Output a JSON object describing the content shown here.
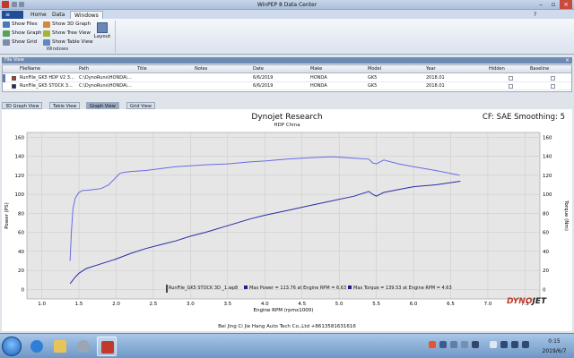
{
  "window": {
    "title": "WinPEP 8 Data Center"
  },
  "ribbon_tabs": [
    "Home",
    "Data",
    "Windows"
  ],
  "ribbon": {
    "buttons": [
      "Show Files",
      "Show Graph",
      "Show Grid",
      "Show 3D Graph",
      "Show Tree View",
      "Show Table View"
    ],
    "layout_label": "Layout",
    "group_label": "Windows"
  },
  "file_view": {
    "title": "File View",
    "columns": [
      "FileName",
      "Path",
      "Title",
      "Notes",
      "Date",
      "Make",
      "Model",
      "Year",
      "Hidden",
      "Baseline"
    ],
    "rows": [
      {
        "filename": "RunFile_GK5 HDP V2 3...",
        "path": "C:\\DynoRuns\\HONDA\\...",
        "title": "",
        "notes": "",
        "date": "6/6/2019",
        "make": "HONDA",
        "model": "GK5",
        "year": "2018.01",
        "color": "#c0392b"
      },
      {
        "filename": "RunFile_GK5 STOCK 3...",
        "path": "C:\\DynoRuns\\HONDA\\...",
        "title": "",
        "notes": "",
        "date": "6/6/2019",
        "make": "HONDA",
        "model": "GK5",
        "year": "2018.01",
        "color": "#1a237e"
      }
    ]
  },
  "view_tabs": [
    "3D Graph View",
    "Table View",
    "Graph View",
    "Grid View"
  ],
  "graph": {
    "title": "Dynojet Research",
    "subtitle": "HDP China",
    "cf_text": "CF: SAE Smoothing: 5",
    "footer": "Bei Jing Ci Jie Hang Auto Tech Co.,Ltd +8613581631616",
    "legend": {
      "file": "RunFile_GK5 STOCK 3D _1.wp8",
      "power": "Max Power = 113.76 at Engine RPM = 6.63",
      "torque": "Max Torque = 139.53 at Engine RPM = 4.63"
    },
    "logo": {
      "red": "DYNO",
      "dark": "JET"
    }
  },
  "chart_data": {
    "type": "line",
    "title": "Dynojet Research",
    "subtitle": "HDP China",
    "xlabel": "Engine RPM (rpmx1000)",
    "ylabel": "Power (PS)",
    "y2label": "Torque (Nm)",
    "xlim": [
      0.8,
      7.7
    ],
    "ylim": [
      -10,
      165
    ],
    "y2lim": [
      -10,
      165
    ],
    "xticks": [
      "1.0",
      "1.5",
      "2.0",
      "2.5",
      "3.0",
      "3.5",
      "4.0",
      "4.5",
      "5.0",
      "5.5",
      "6.0",
      "6.5",
      "7.0",
      "7.5"
    ],
    "yticks": [
      "0",
      "20",
      "40",
      "60",
      "80",
      "100",
      "120",
      "140",
      "160"
    ],
    "grid": true,
    "series": [
      {
        "name": "Torque",
        "color": "#6a6ae8",
        "x": [
          1.38,
          1.4,
          1.42,
          1.45,
          1.5,
          1.55,
          1.6,
          1.7,
          1.8,
          1.9,
          2.0,
          2.05,
          2.1,
          2.2,
          2.4,
          2.6,
          2.8,
          3.0,
          3.2,
          3.5,
          3.8,
          4.0,
          4.3,
          4.6,
          4.9,
          5.2,
          5.4,
          5.45,
          5.5,
          5.6,
          5.8,
          6.0,
          6.3,
          6.62
        ],
        "y": [
          30,
          62,
          85,
          96,
          102,
          104,
          104,
          105,
          106,
          110,
          118,
          122,
          123,
          124,
          125,
          127,
          129,
          130,
          131,
          132,
          134,
          135,
          137,
          138.5,
          139.5,
          138,
          137,
          133,
          132,
          136,
          132,
          129,
          125,
          120
        ]
      },
      {
        "name": "Power",
        "color": "#2a2aa8",
        "x": [
          1.38,
          1.4,
          1.45,
          1.5,
          1.6,
          1.8,
          2.0,
          2.2,
          2.4,
          2.6,
          2.8,
          3.0,
          3.2,
          3.5,
          3.8,
          4.0,
          4.3,
          4.6,
          4.9,
          5.2,
          5.4,
          5.45,
          5.5,
          5.6,
          5.8,
          6.0,
          6.3,
          6.63
        ],
        "y": [
          6,
          8,
          13,
          17,
          22,
          27,
          32,
          38,
          43,
          47,
          51,
          56,
          60,
          67,
          74,
          78,
          83,
          88,
          93,
          98,
          103,
          100,
          98,
          102,
          105,
          108,
          110,
          113.76
        ]
      }
    ]
  },
  "taskbar": {
    "time": "0:15",
    "date": "2019/6/7"
  }
}
